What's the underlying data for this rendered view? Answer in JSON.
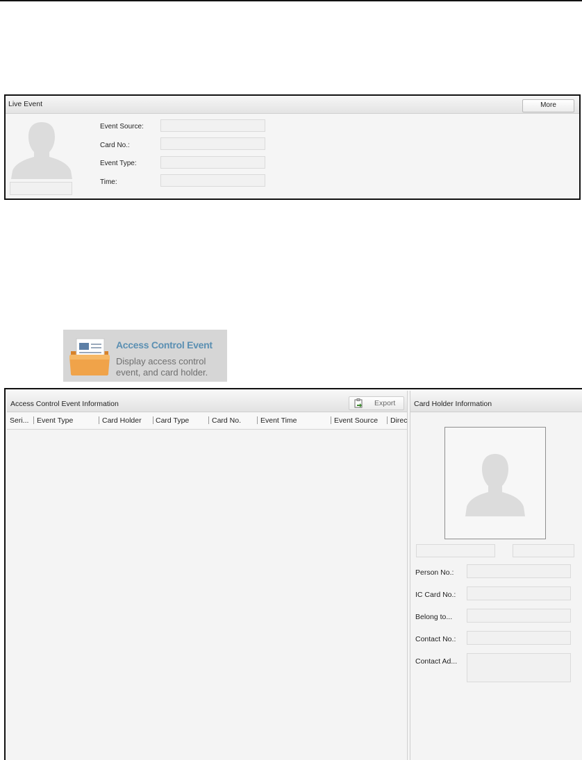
{
  "live_event": {
    "title": "Live Event",
    "more_button": "More",
    "fields": [
      {
        "label": "Event Source:",
        "value": ""
      },
      {
        "label": "Card No.:",
        "value": ""
      },
      {
        "label": "Event Type:",
        "value": ""
      },
      {
        "label": "Time:",
        "value": ""
      }
    ],
    "avatar_icon": "person-silhouette-icon"
  },
  "app_tile": {
    "icon": "folder-documents-icon",
    "title": "Access Control Event",
    "description": "Display access control event, and card holder."
  },
  "access_control": {
    "title": "Access Control Event Information",
    "export_button": "Export",
    "export_icon": "export-clipboard-icon",
    "columns": [
      "Seri...",
      "Event Type",
      "Card Holder",
      "Card Type",
      "Card No.",
      "Event Time",
      "Event Source",
      "Direc"
    ],
    "rows": []
  },
  "card_holder": {
    "title": "Card Holder Information",
    "photo_icon": "person-silhouette-icon",
    "fields": [
      {
        "label": "Person No.:",
        "value": ""
      },
      {
        "label": "IC Card No.:",
        "value": ""
      },
      {
        "label": "Belong to...",
        "value": ""
      },
      {
        "label": "Contact No.:",
        "value": ""
      },
      {
        "label": "Contact Ad...",
        "value": ""
      }
    ]
  },
  "colors": {
    "panel_bg": "#f5f5f5",
    "header_bg": "#e3e3e3",
    "tile_title": "#5a8fb2",
    "tile_bg": "#d6d6d6",
    "folder_orange": "#e8962e"
  }
}
